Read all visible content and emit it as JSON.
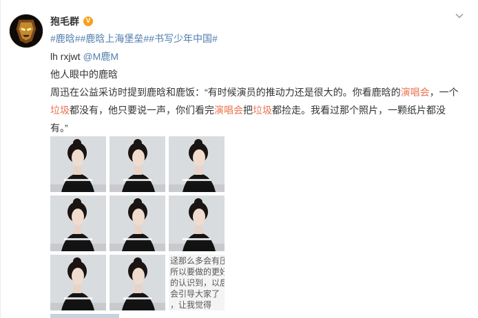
{
  "post": {
    "author": "狍毛群",
    "verified_badge": "V",
    "line_tags": [
      "#鹿晗#",
      "#鹿晗上海堡垒#",
      "#书写少年中国#"
    ],
    "line2_prefix": "lh rxjwt ",
    "line2_mention": "@M鹿M",
    "line3": "他人眼中的鹿晗",
    "para1_a": "周迅在公益采访时提到鹿晗和鹿饭：“有时候演员的推动力还是很大的。你看鹿晗的",
    "para1_hl1": "演唱会",
    "para1_b": "，一个",
    "para2_hl1": "垃圾",
    "para2_a": "都没有，他只要说一声，你们看完",
    "para2_hl2": "演唱会",
    "para2_b": "把",
    "para2_hl3": "垃圾",
    "para2_c": "都捡走。我看过那个照片，一颗纸片都没",
    "para3": "有。”"
  },
  "images": {
    "text_thumb_lines": [
      "迳那么多会有压力",
      "所以要做的更好",
      "的认识到，以后",
      "会引导大家了",
      "，让我觉得"
    ]
  },
  "icons": {
    "more": "chevron-down-icon",
    "avatar": "avatar-image"
  },
  "colors": {
    "link": "#507daf",
    "highlight": "#eb7350",
    "badge": "#f7a01b"
  }
}
